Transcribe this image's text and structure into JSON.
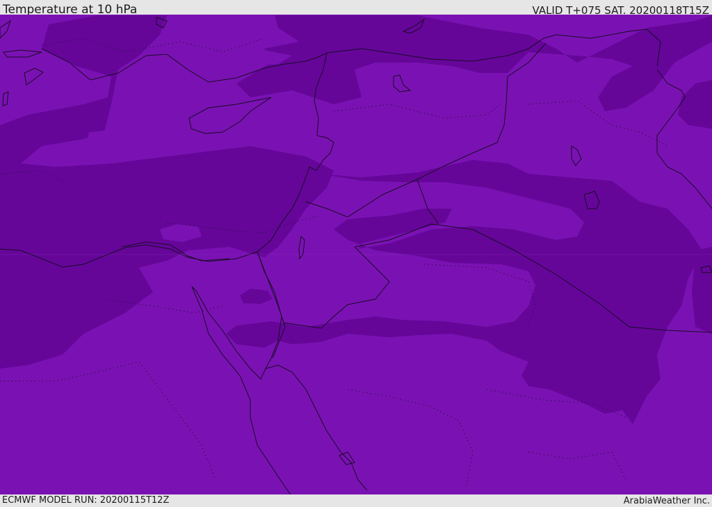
{
  "header": {
    "title": "Temperature at 10 hPa",
    "valid_time": "VALID T+075 SAT. 20200118T15Z"
  },
  "footer": {
    "model_run": "ECMWF MODEL RUN: 20200115T12Z",
    "credit": "ArabiaWeather Inc."
  },
  "colors": {
    "field_light": "#7a12b3",
    "field_dark": "#650699",
    "coastline": "#1a0a26",
    "frame": "#e6e6e6"
  }
}
